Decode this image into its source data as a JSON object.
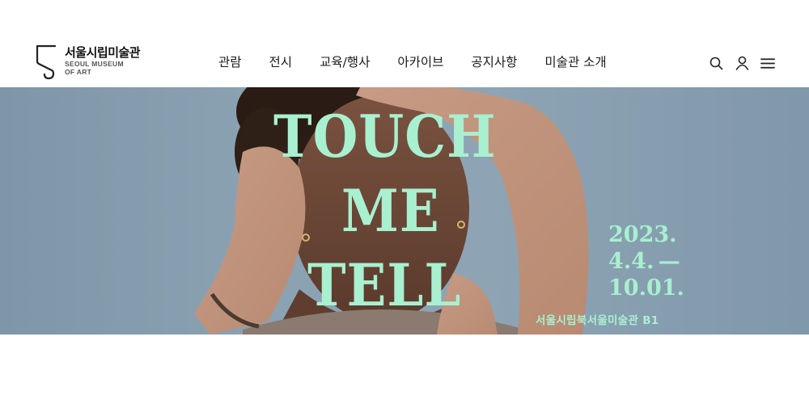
{
  "header": {
    "logo_ko": "서울시립미술관",
    "logo_en_line1": "SEOUL MUSEUM",
    "logo_en_line2": "OF ART"
  },
  "nav": {
    "items": [
      {
        "label": "관람"
      },
      {
        "label": "전시"
      },
      {
        "label": "교육/행사"
      },
      {
        "label": "아카이브"
      },
      {
        "label": "공지사항"
      },
      {
        "label": "미술관 소개"
      }
    ]
  },
  "tools": {
    "search_icon": "search-icon",
    "user_icon": "user-icon",
    "menu_icon": "hamburger-menu-icon"
  },
  "hero": {
    "title_line1": "TOUCH",
    "title_line2": "ME",
    "title_line3": "TELL",
    "date_line1": "2023.",
    "date_line2": "4.4. —",
    "date_line3": "10.01.",
    "venue": "서울시립북서울미술관 B1",
    "accent_color": "#a8f0d0",
    "background_color": "#8ea4b5"
  }
}
